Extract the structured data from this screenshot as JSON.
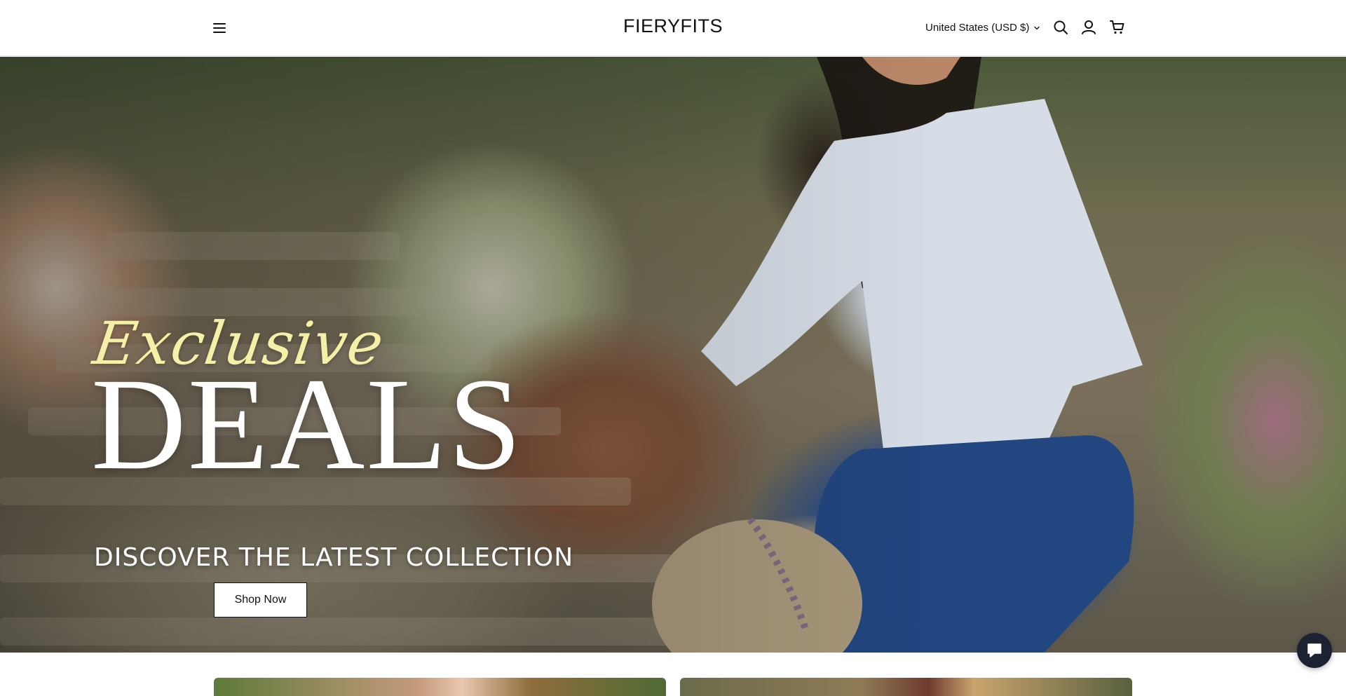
{
  "header": {
    "logo": "FIERYFITS",
    "currency": "United States (USD $)",
    "icons": [
      "menu-icon",
      "search-icon",
      "account-icon",
      "cart-icon"
    ]
  },
  "hero": {
    "script_text": "Exclusive",
    "headline": "DEALS",
    "subheadline": "DISCOVER THE LATEST COLLECTION",
    "cta_label": "Shop Now"
  },
  "colors": {
    "header_bg": "#ffffff",
    "script_accent": "#f4f0a8",
    "button_bg": "#ffffff",
    "chat_bg": "#1d2233"
  }
}
